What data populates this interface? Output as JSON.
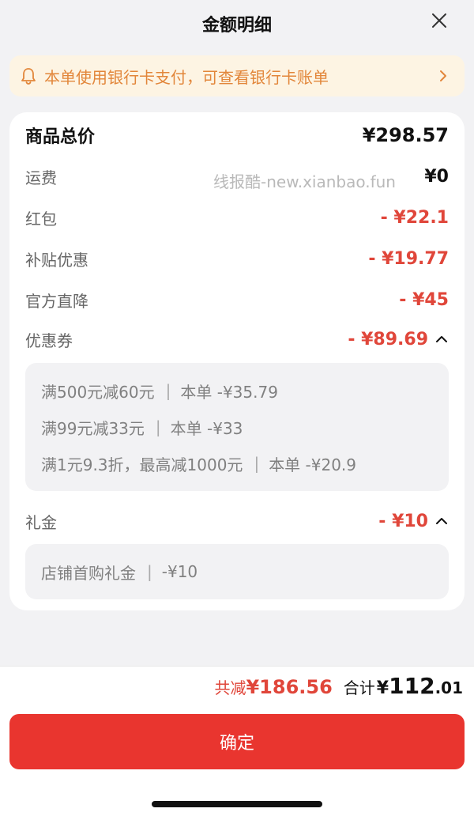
{
  "header": {
    "title": "金额明细",
    "close_icon": "close-icon"
  },
  "banner": {
    "text": "本单使用银行卡支付，可查看银行卡账单",
    "icon": "bell-icon",
    "color": "#e2863a"
  },
  "watermark": "线报酷-new.xianbao.fun",
  "rows": {
    "total": {
      "label": "商品总价",
      "value": "¥298.57"
    },
    "shipping": {
      "label": "运费",
      "value": "¥0"
    },
    "red_packet": {
      "label": "红包",
      "value": "- ¥22.1"
    },
    "subsidy": {
      "label": "补贴优惠",
      "value": "- ¥19.77"
    },
    "official": {
      "label": "官方直降",
      "value": "- ¥45"
    },
    "coupon": {
      "label": "优惠券",
      "value": "- ¥89.69"
    },
    "gift": {
      "label": "礼金",
      "value": "- ¥10"
    }
  },
  "coupon_details": [
    {
      "rule": "满500元减60元",
      "amount": "本单 -¥35.79"
    },
    {
      "rule": "满99元减33元",
      "amount": "本单 -¥33"
    },
    {
      "rule": "满1元9.3折，最高减1000元",
      "amount": "本单 -¥20.9"
    }
  ],
  "gift_details": [
    {
      "rule": "店铺首购礼金",
      "amount": "-¥10"
    }
  ],
  "footer": {
    "saved_label": "共减",
    "saved_value": "¥186.56",
    "sum_label": "合计",
    "sum_yen": "¥",
    "sum_int": "112",
    "sum_dec": ".01",
    "confirm_label": "确定"
  },
  "colors": {
    "accent": "#e9352f",
    "discount": "#e0463a",
    "banner_bg": "#fdf4e3"
  }
}
